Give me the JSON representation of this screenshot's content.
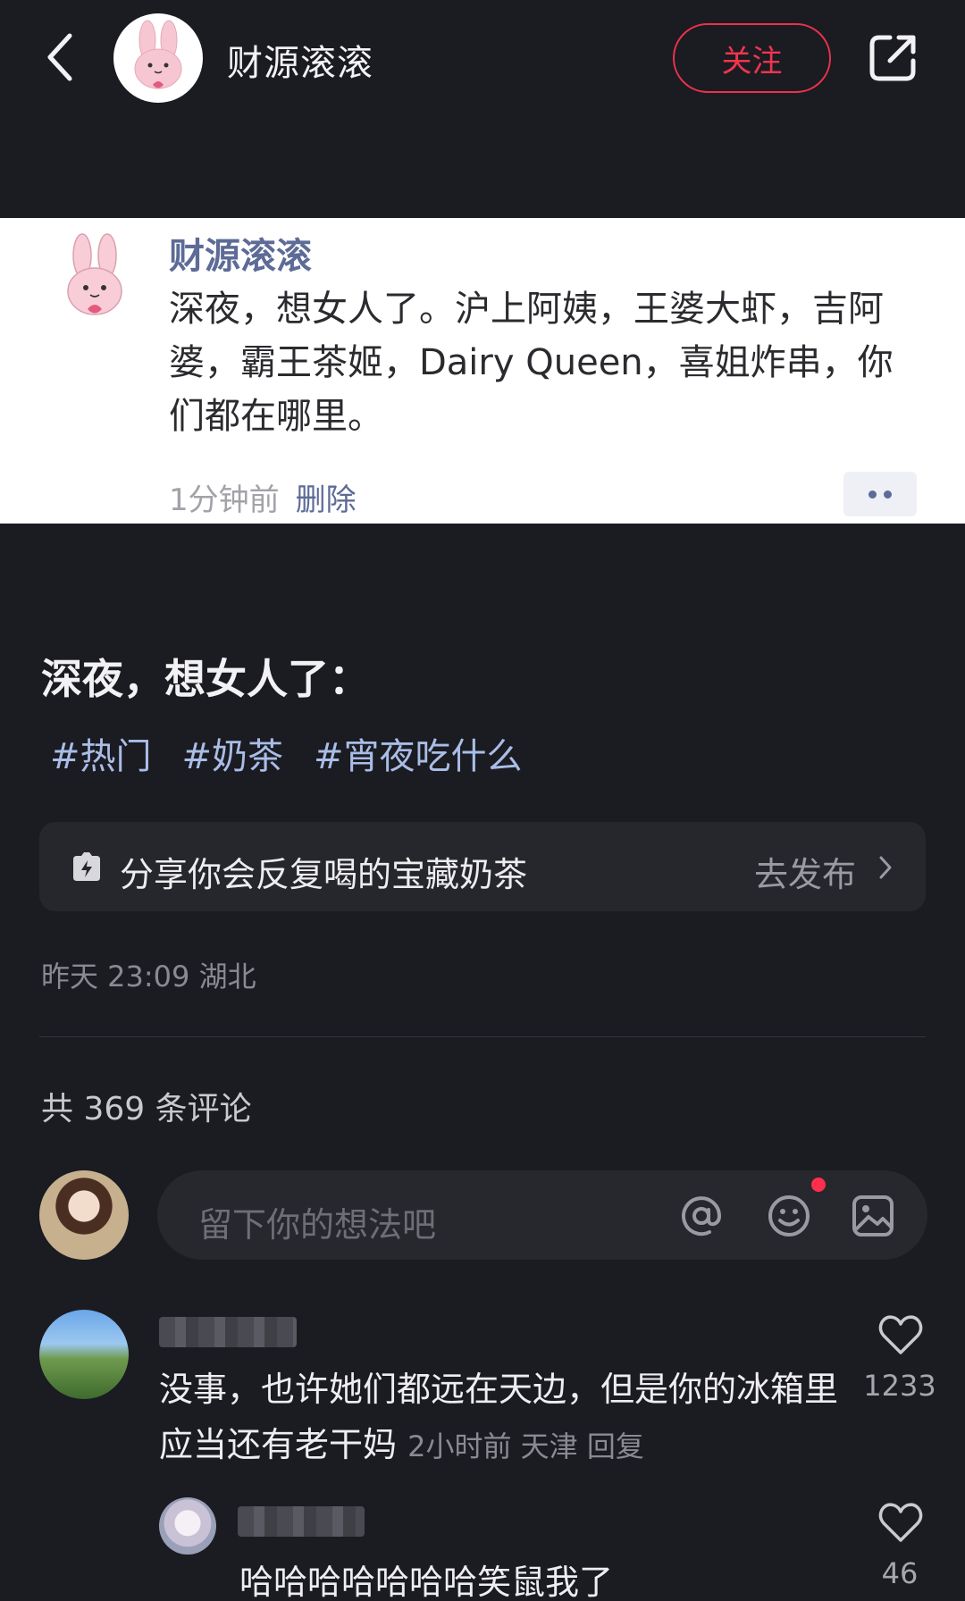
{
  "header": {
    "username": "财源滚滚",
    "follow_label": "关注",
    "icons": {
      "back": "chevron-left-icon",
      "share": "share-external-icon"
    }
  },
  "post_card": {
    "author": "财源滚滚",
    "text": "深夜，想女人了。沪上阿姨，王婆大虾，吉阿婆，霸王茶姬，Dairy Queen，喜姐炸串，你们都在哪里。",
    "time": "1分钟前",
    "delete_label": "删除"
  },
  "note": {
    "title": "深夜，想女人了：",
    "tags": [
      "#热门",
      "#奶茶",
      "#宵夜吃什么"
    ],
    "topic": {
      "text": "分享你会反复喝的宝藏奶茶",
      "action": "去发布"
    },
    "posted": "昨天 23:09 湖北"
  },
  "comments_section": {
    "count_label": "共 369 条评论",
    "input_placeholder": "留下你的想法吧",
    "comments": [
      {
        "text": "没事，也许她们都远在天边，但是你的冰箱里应当还有老干妈",
        "time": "2小时前",
        "location": "天津",
        "reply_label": "回复",
        "likes": "1233"
      },
      {
        "text": "哈哈哈哈哈哈哈笑鼠我了",
        "likes": "46"
      }
    ]
  },
  "colors": {
    "background": "#1b1b22",
    "follow_red": "#e8334a",
    "tag_blue": "#a9bde6",
    "card_name_blue": "#5d6b96"
  }
}
